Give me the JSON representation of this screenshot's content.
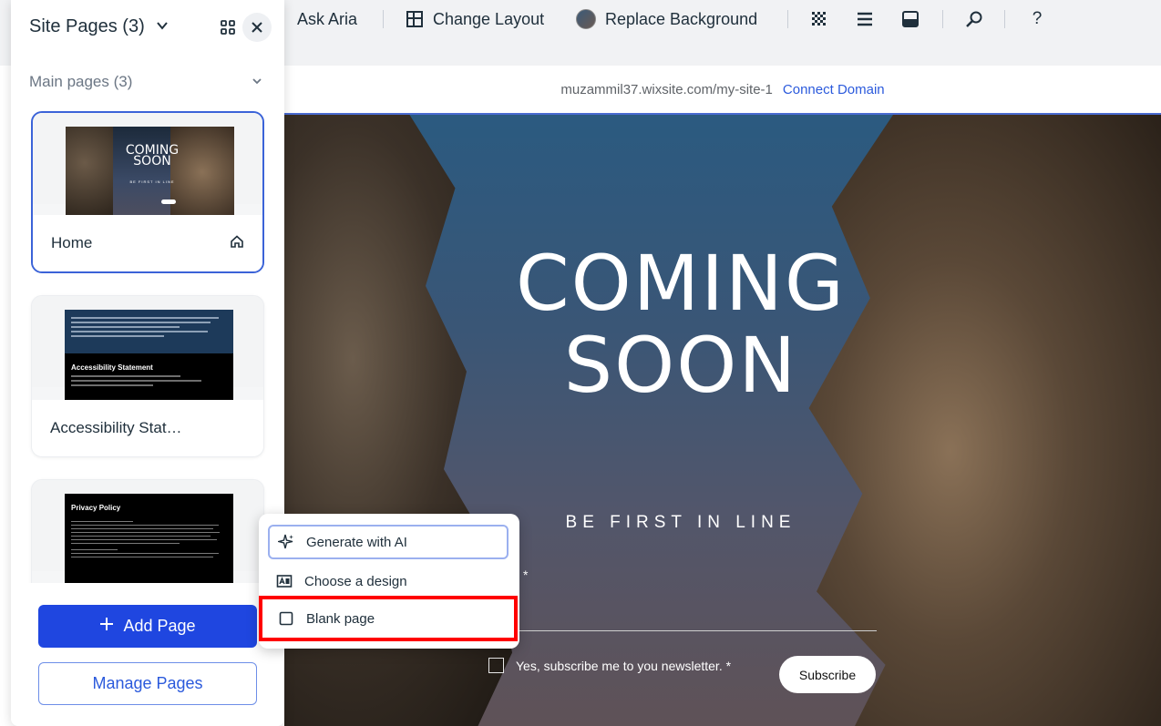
{
  "toolbar": {
    "ask_aria": "Ask Aria",
    "change_layout": "Change Layout",
    "replace_background": "Replace Background"
  },
  "address_bar": {
    "url": "muzammil37.wixsite.com/my-site-1",
    "connect_domain": "Connect Domain"
  },
  "canvas": {
    "title_line1": "COMING",
    "title_line2": "SOON",
    "be_first": "BE FIRST IN LINE",
    "email_label_fragment": "l *",
    "newsletter_label": "Yes, subscribe me to you newsletter. *",
    "subscribe_label": "Subscribe"
  },
  "panel": {
    "title": "Site Pages (3)",
    "section_title": "Main pages (3)",
    "pages": [
      {
        "label": "Home",
        "thumb_title_1": "COMING",
        "thumb_title_2": "SOON",
        "thumb_sub": "BE FIRST IN LINE"
      },
      {
        "label": "Accessibility Stat…",
        "thumb_title": "Accessibility Statement"
      },
      {
        "label": "",
        "thumb_title": "Privacy Policy"
      }
    ],
    "add_page_label": "Add Page",
    "manage_pages_label": "Manage Pages"
  },
  "add_menu": {
    "items": [
      {
        "label": "Generate with AI",
        "icon": "sparkle-icon"
      },
      {
        "label": "Choose a design",
        "icon": "design-icon"
      },
      {
        "label": "Blank page",
        "icon": "blank-page-icon"
      }
    ]
  },
  "colors": {
    "accent": "#1f46e0",
    "link": "#2b5adc",
    "highlight": "#ff0000"
  }
}
